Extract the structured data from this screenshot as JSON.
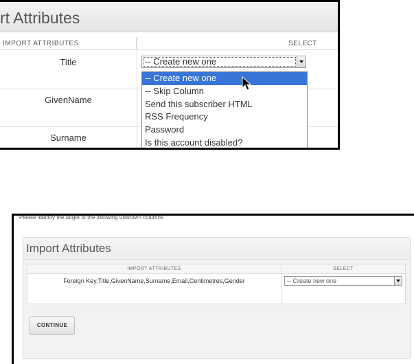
{
  "top": {
    "heading": "rt Attributes",
    "col_import": "IMPORT ATTRIBUTES",
    "col_select": "SELECT",
    "rows": [
      "Title",
      "GivenName",
      "Surname"
    ],
    "select_value": "-- Create new one",
    "options": [
      "-- Create new one",
      "-- Skip Column",
      "Send this subscriber HTML",
      "RSS Frequency",
      "Password",
      "Is this account disabled?"
    ]
  },
  "bottom": {
    "instruction": "Please identify the target of the following unknown columns",
    "card_title": "Import Attributes",
    "col_import": "IMPORT ATTRIBUTES",
    "col_select": "SELECT",
    "row_label": "Foreign Key,Title,GivenName,Surname,Email,Centimetres,Gender",
    "select_value": "-- Create new one",
    "continue_label": "CONTINUE"
  }
}
